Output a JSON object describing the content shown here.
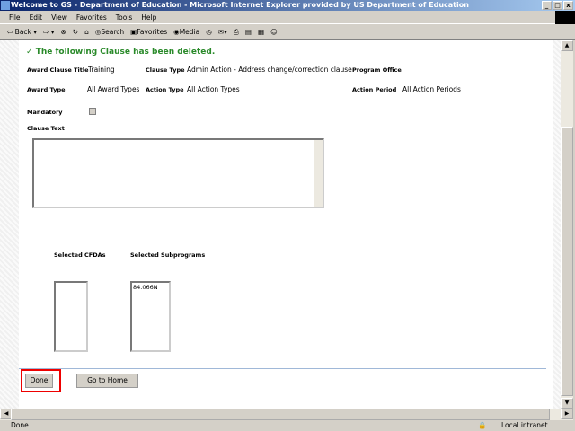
{
  "window": {
    "title": "Welcome to GS - Department of Education - Microsoft Internet Explorer provided by US Department of Education"
  },
  "menu": [
    "File",
    "Edit",
    "View",
    "Favorites",
    "Tools",
    "Help"
  ],
  "toolbar": {
    "back": "Back",
    "search": "Search",
    "favorites": "Favorites",
    "media": "Media"
  },
  "page": {
    "message": "The following Clause has been deleted.",
    "award_clause_title_label": "Award Clause Title",
    "award_clause_title": "Training",
    "clause_type_label": "Clause Type",
    "clause_type": "Admin Action - Address change/correction clause",
    "program_office_label": "Program Office",
    "program_office": "",
    "award_type_label": "Award Type",
    "award_type": "All Award Types",
    "action_type_label": "Action Type",
    "action_type": "All Action Types",
    "action_period_label": "Action Period",
    "action_period": "All Action Periods",
    "mandatory_label": "Mandatory",
    "mandatory_checked": false,
    "clause_text_label": "Clause Text",
    "clause_text": "",
    "cfdas_label": "Selected CFDAs",
    "cfdas": [],
    "subprograms_label": "Selected Subprograms",
    "subprograms": [
      "84.066N"
    ],
    "done_label": "Done",
    "home_label": "Go to Home"
  },
  "status": {
    "text": "Done",
    "zone": "Local intranet"
  }
}
